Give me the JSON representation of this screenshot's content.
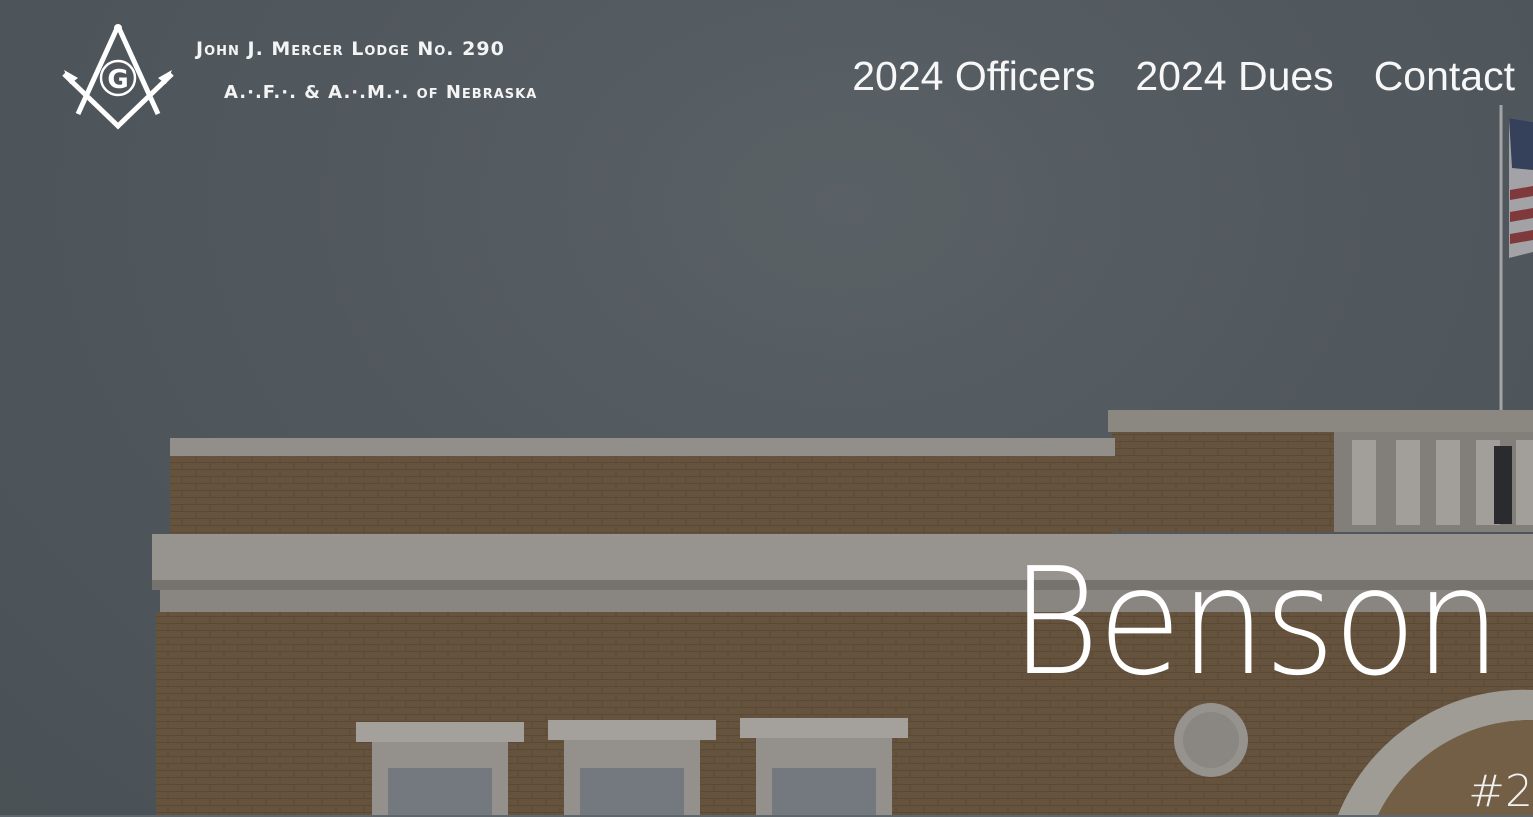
{
  "logo": {
    "line1": "John J. Mercer Lodge No. 290",
    "line2": "A.·.F.·. & A.·.M.·. of Nebraska",
    "emblem_letter": "G",
    "emblem_icon": "square-and-compasses-icon"
  },
  "nav": {
    "items": [
      {
        "label": "2024 Officers"
      },
      {
        "label": "2024 Dues"
      },
      {
        "label": "Contact"
      }
    ]
  },
  "hero": {
    "title": "Benson",
    "subtitle": "#2"
  },
  "colors": {
    "sky": "#5e676d",
    "brick": "#7d6548",
    "trim": "#bdb8b0",
    "text": "#ffffff"
  }
}
